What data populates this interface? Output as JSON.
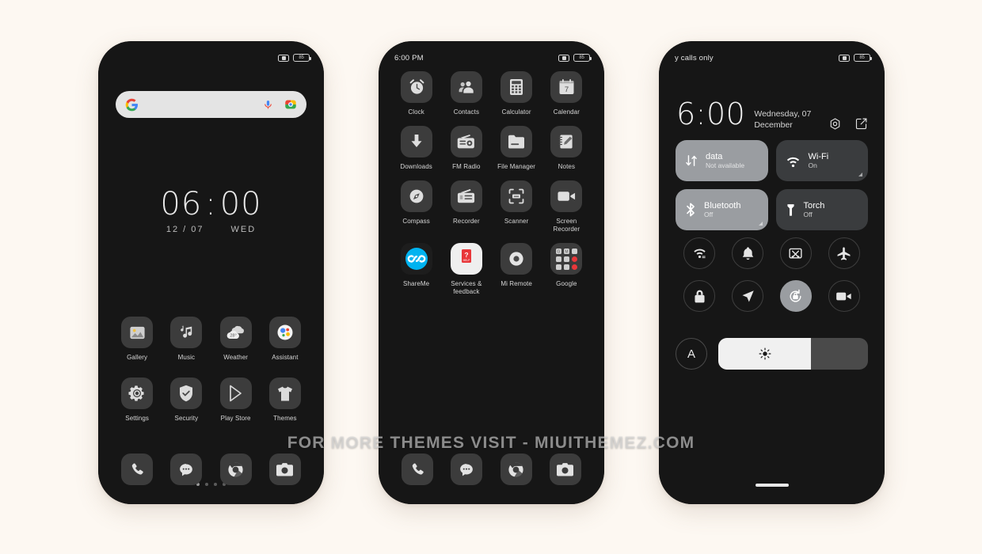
{
  "page": {
    "background_color": "#fdf8f2",
    "watermark": "FOR MORE THEMES VISIT - MIUITHEMEZ.COM"
  },
  "phone_home": {
    "status_bar": {
      "left_text": "",
      "battery": "85",
      "icons": [
        "no-sim-icon",
        "battery-icon"
      ]
    },
    "search": {
      "placeholder": "",
      "google_logo": "google-g-logo",
      "mic": "mic-icon",
      "lens": "google-lens-icon"
    },
    "clock": {
      "hours": "06",
      "colon": ":",
      "minutes": "00",
      "date": "12 / 07",
      "day": "WED"
    },
    "apps": [
      {
        "label": "Gallery",
        "icon": "gallery-icon"
      },
      {
        "label": "Music",
        "icon": "music-note-icon"
      },
      {
        "label": "Weather",
        "icon": "weather-cloud-icon",
        "badge": "28°"
      },
      {
        "label": "Assistant",
        "icon": "google-assistant-icon"
      },
      {
        "label": "Settings",
        "icon": "gear-icon"
      },
      {
        "label": "Security",
        "icon": "shield-check-icon"
      },
      {
        "label": "Play Store",
        "icon": "play-store-icon"
      },
      {
        "label": "Themes",
        "icon": "tshirt-icon"
      }
    ],
    "page_dots": {
      "count": 4,
      "active_index": 0
    },
    "dock": [
      {
        "label": "Phone",
        "icon": "phone-handset-icon"
      },
      {
        "label": "Messages",
        "icon": "chat-bubble-icon"
      },
      {
        "label": "Chrome",
        "icon": "chrome-icon"
      },
      {
        "label": "Camera",
        "icon": "camera-icon"
      }
    ]
  },
  "phone_drawer": {
    "status_bar": {
      "left_text": "6:00 PM",
      "battery": "85"
    },
    "apps": [
      {
        "label": "Clock",
        "icon": "alarm-clock-icon"
      },
      {
        "label": "Contacts",
        "icon": "contacts-people-icon"
      },
      {
        "label": "Calculator",
        "icon": "calculator-icon"
      },
      {
        "label": "Calendar",
        "icon": "calendar-icon",
        "badge": "7"
      },
      {
        "label": "Downloads",
        "icon": "download-arrow-icon"
      },
      {
        "label": "FM Radio",
        "icon": "radio-icon"
      },
      {
        "label": "File Manager",
        "icon": "folder-icon"
      },
      {
        "label": "Notes",
        "icon": "notepad-pencil-icon"
      },
      {
        "label": "Compass",
        "icon": "compass-icon"
      },
      {
        "label": "Recorder",
        "icon": "tape-recorder-icon"
      },
      {
        "label": "Scanner",
        "icon": "scanner-frame-icon"
      },
      {
        "label": "Screen\nRecorder",
        "icon": "video-camera-icon"
      },
      {
        "label": "ShareMe",
        "icon": "shareme-infinity-icon"
      },
      {
        "label": "Services &\nfeedback",
        "icon": "services-feedback-icon"
      },
      {
        "label": "Mi Remote",
        "icon": "mi-remote-icon"
      },
      {
        "label": "Google",
        "icon": "google-folder-icon"
      }
    ],
    "dock": [
      {
        "label": "Phone",
        "icon": "phone-handset-icon"
      },
      {
        "label": "Messages",
        "icon": "chat-bubble-icon"
      },
      {
        "label": "Chrome",
        "icon": "chrome-icon"
      },
      {
        "label": "Camera",
        "icon": "camera-icon"
      }
    ]
  },
  "phone_control_center": {
    "status_bar": {
      "left_text": "y calls only",
      "battery": "85"
    },
    "clock": {
      "time": "6:00",
      "date_line1": "Wednesday, 07",
      "date_line2": "December"
    },
    "header_actions": [
      {
        "name": "settings-gear-icon",
        "label": "Settings"
      },
      {
        "name": "edit-tiles-icon",
        "label": "Edit"
      }
    ],
    "tiles": [
      {
        "title": "data",
        "subtitle": "Not available",
        "state": "on",
        "icon": "mobile-data-icon",
        "expandable": false
      },
      {
        "title": "Wi-Fi",
        "subtitle": "On",
        "state": "off",
        "icon": "wifi-icon",
        "expandable": true
      },
      {
        "title": "Bluetooth",
        "subtitle": "Off",
        "state": "on",
        "icon": "bluetooth-icon",
        "expandable": true
      },
      {
        "title": "Torch",
        "subtitle": "Off",
        "state": "off",
        "icon": "flashlight-icon",
        "expandable": false
      }
    ],
    "circle_toggles": [
      {
        "icon": "wifi-share-icon",
        "label": "Hotspot",
        "active": false
      },
      {
        "icon": "bell-icon",
        "label": "Sound",
        "active": false
      },
      {
        "icon": "cast-icon",
        "label": "Cast",
        "active": false
      },
      {
        "icon": "airplane-icon",
        "label": "Airplane mode",
        "active": false
      },
      {
        "icon": "lock-icon",
        "label": "Lock",
        "active": false
      },
      {
        "icon": "location-arrow-icon",
        "label": "Location",
        "active": false
      },
      {
        "icon": "auto-rotate-icon",
        "label": "Auto-rotate",
        "active": true
      },
      {
        "icon": "video-camera-icon",
        "label": "Screen record",
        "active": false
      }
    ],
    "brightness": {
      "auto_label": "A",
      "icon": "brightness-sun-icon",
      "value_percent": 62
    },
    "home_indicator": true
  }
}
